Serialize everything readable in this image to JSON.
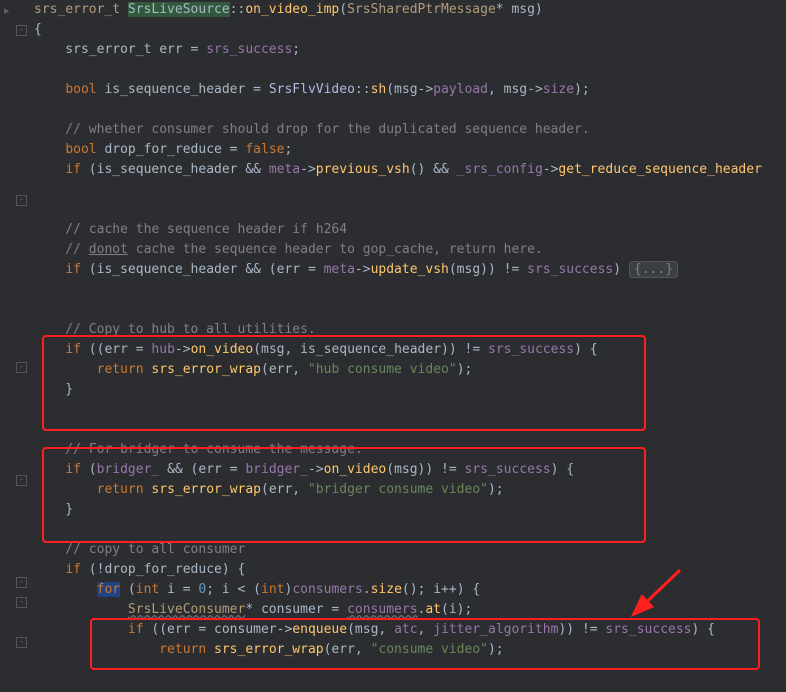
{
  "code": {
    "l1_ret": "srs_error_t ",
    "l1_cls": "SrsLiveSource",
    "l1_scope": "::",
    "l1_fn": "on_video_imp",
    "l1_paren_open": "(",
    "l1_param_type": "SrsSharedPtrMessage",
    "l1_param_rest": "* msg)",
    "l2": "{",
    "l3_a": "    srs_error_t err = ",
    "l3_b": "srs_success",
    "l3_c": ";",
    "l5_a": "    ",
    "l5_b": "bool",
    "l5_c": " is_sequence_header = ",
    "l5_d": "SrsFlvVideo",
    "l5_e": "::",
    "l5_f": "sh",
    "l5_g": "(msg->",
    "l5_h": "payload",
    "l5_i": ", msg->",
    "l5_j": "size",
    "l5_k": ");",
    "l7": "    // whether consumer should drop for the duplicated sequence header.",
    "l8_a": "    ",
    "l8_b": "bool",
    "l8_c": " drop_for_reduce = ",
    "l8_d": "false",
    "l8_e": ";",
    "l9_a": "    ",
    "l9_b": "if",
    "l9_c": " (is_sequence_header && ",
    "l9_d": "meta",
    "l9_e": "->",
    "l9_f": "previous_vsh",
    "l9_g": "() && ",
    "l9_h": "_srs_config",
    "l9_i": "->",
    "l9_j": "get_reduce_sequence_header",
    "l12": "    // cache the sequence header if h264",
    "l13_a": "    // ",
    "l13_b": "donot",
    "l13_c": " cache the sequence header to gop_cache, return here.",
    "l14_a": "    ",
    "l14_b": "if",
    "l14_c": " (is_sequence_header && (err = ",
    "l14_d": "meta",
    "l14_e": "->",
    "l14_f": "update_vsh",
    "l14_g": "(msg)) != ",
    "l14_h": "srs_success",
    "l14_i": ") ",
    "l14_fold": "{...}",
    "l16": "    // Copy to hub to all utilities.",
    "l17_a": "    ",
    "l17_b": "if",
    "l17_c": " ((err = ",
    "l17_d": "hub",
    "l17_e": "->",
    "l17_f": "on_video",
    "l17_g": "(msg, is_sequence_header)) != ",
    "l17_h": "srs_success",
    "l17_i": ") {",
    "l18_a": "        ",
    "l18_b": "return",
    "l18_c": " ",
    "l18_d": "srs_error_wrap",
    "l18_e": "(err, ",
    "l18_f": "\"hub consume video\"",
    "l18_g": ");",
    "l19": "    }",
    "l21": "    // For bridger to consume the message.",
    "l22_a": "    ",
    "l22_b": "if",
    "l22_c": " (",
    "l22_d": "bridger_",
    "l22_e": " && (err = ",
    "l22_f": "bridger_",
    "l22_g": "->",
    "l22_h": "on_video",
    "l22_i": "(msg)) != ",
    "l22_j": "srs_success",
    "l22_k": ") {",
    "l23_a": "        ",
    "l23_b": "return",
    "l23_c": " ",
    "l23_d": "srs_error_wrap",
    "l23_e": "(err, ",
    "l23_f": "\"bridger consume video\"",
    "l23_g": ");",
    "l24": "    }",
    "l26": "    // copy to all consumer",
    "l27_a": "    ",
    "l27_b": "if",
    "l27_c": " (!drop_for_reduce) {",
    "l28_a": "        ",
    "l28_b": "for",
    "l28_c": " (",
    "l28_d": "int",
    "l28_e": " i = ",
    "l28_f": "0",
    "l28_g": "; i < (",
    "l28_h": "int",
    "l28_i": ")",
    "l28_j": "consumers",
    "l28_k": ".",
    "l28_l": "size",
    "l28_m": "(); i++) {",
    "l29_a": "            ",
    "l29_b": "SrsLiveConsumer",
    "l29_c": "* consumer = ",
    "l29_d": "consumers",
    "l29_e": ".",
    "l29_f": "at",
    "l29_g": "(i);",
    "l30_a": "            ",
    "l30_b": "if",
    "l30_c": " ((err = consumer->",
    "l30_d": "enqueue",
    "l30_e": "(msg, ",
    "l30_f": "atc",
    "l30_g": ", ",
    "l30_h": "jitter_algorithm",
    "l30_i": ")) != ",
    "l30_j": "srs_success",
    "l30_k": ") {",
    "l31_a": "                ",
    "l31_b": "return",
    "l31_c": " ",
    "l31_d": "srs_error_wrap",
    "l31_e": "(err, ",
    "l31_f": "\"consume video\"",
    "l31_g": ");"
  },
  "hint": "▸"
}
